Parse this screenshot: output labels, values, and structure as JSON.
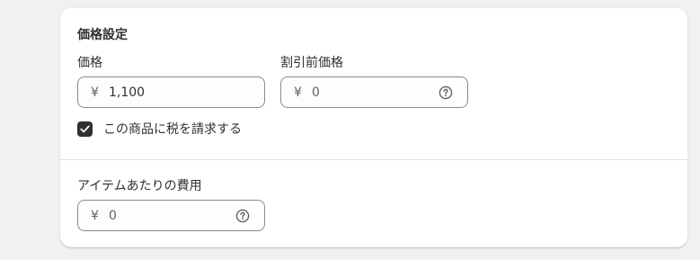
{
  "pricing": {
    "title": "価格設定",
    "price": {
      "label": "価格",
      "currency_symbol": "¥",
      "value": "1,100"
    },
    "compare_at_price": {
      "label": "割引前価格",
      "currency_symbol": "¥",
      "placeholder": "0",
      "help_icon": "question-circle-icon"
    },
    "charge_tax": {
      "label": "この商品に税を請求する",
      "checked": true
    },
    "cost_per_item": {
      "label": "アイテムあたりの費用",
      "currency_symbol": "¥",
      "placeholder": "0",
      "help_icon": "question-circle-icon"
    }
  },
  "colors": {
    "page_background": "#f1f1f1",
    "card_background": "#ffffff",
    "checkbox_fill": "#303030",
    "input_border": "#8a8a8a"
  }
}
